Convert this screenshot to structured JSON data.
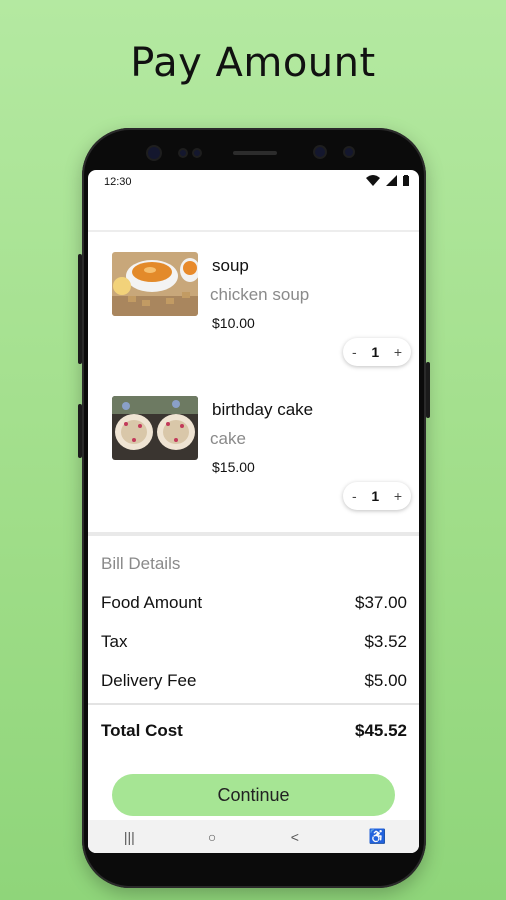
{
  "headline": "Pay Amount",
  "status_bar": {
    "time": "12:30"
  },
  "cart": {
    "items": [
      {
        "name": "soup",
        "category": "chicken soup",
        "price": "$10.00",
        "quantity": "1",
        "minus": "-",
        "plus": "+"
      },
      {
        "name": "birthday cake",
        "category": "cake",
        "price": "$15.00",
        "quantity": "1",
        "minus": "-",
        "plus": "+"
      }
    ]
  },
  "bill": {
    "title": "Bill Details",
    "rows": [
      {
        "label": "Food Amount",
        "value": "$37.00"
      },
      {
        "label": "Tax",
        "value": "$3.52"
      },
      {
        "label": "Delivery Fee",
        "value": "$5.00"
      }
    ],
    "total_label": "Total Cost",
    "total_value": "$45.52"
  },
  "actions": {
    "continue_label": "Continue"
  },
  "nav": {
    "recents": "|||",
    "home": "○",
    "back": "<",
    "accessibility": "♿"
  },
  "colors": {
    "background": "#a9e396",
    "accent": "#a6e594"
  }
}
